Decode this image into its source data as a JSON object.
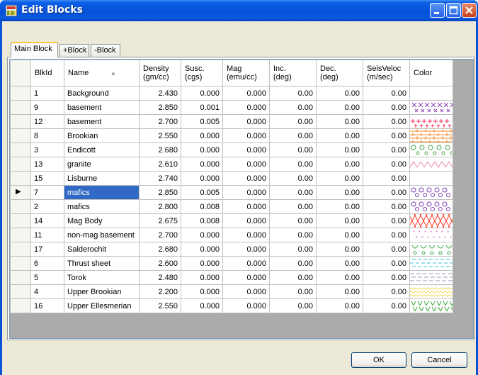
{
  "window": {
    "title": "Edit Blocks"
  },
  "tabs": [
    "Main Block",
    "+Block",
    "-Block"
  ],
  "columns": [
    {
      "l1": "",
      "l2": ""
    },
    {
      "l1": "BlkId",
      "l2": ""
    },
    {
      "l1": "Name",
      "l2": ""
    },
    {
      "l1": "Density",
      "l2": "(gm/cc)"
    },
    {
      "l1": "Susc.",
      "l2": "(cgs)"
    },
    {
      "l1": "Mag",
      "l2": "(emu/cc)"
    },
    {
      "l1": "Inc.",
      "l2": "(deg)"
    },
    {
      "l1": "Dec.",
      "l2": "(deg)"
    },
    {
      "l1": "SeisVeloc",
      "l2": "(m/sec)"
    },
    {
      "l1": "Color",
      "l2": ""
    }
  ],
  "rows": [
    {
      "id": "1",
      "name": "Background",
      "density": "2.430",
      "susc": "0.000",
      "mag": "0.000",
      "inc": "0.00",
      "dec": "0.00",
      "seis": "0.00",
      "swatch": "blank"
    },
    {
      "id": "9",
      "name": "basement",
      "density": "2.850",
      "susc": "0.001",
      "mag": "0.000",
      "inc": "0.00",
      "dec": "0.00",
      "seis": "0.00",
      "swatch": "purple-x"
    },
    {
      "id": "12",
      "name": "basement",
      "density": "2.700",
      "susc": "0.005",
      "mag": "0.000",
      "inc": "0.00",
      "dec": "0.00",
      "seis": "0.00",
      "swatch": "red-plus"
    },
    {
      "id": "8",
      "name": "Brookian",
      "density": "2.550",
      "susc": "0.000",
      "mag": "0.000",
      "inc": "0.00",
      "dec": "0.00",
      "seis": "0.00",
      "swatch": "orange-brick"
    },
    {
      "id": "3",
      "name": "Endicott",
      "density": "2.680",
      "susc": "0.000",
      "mag": "0.000",
      "inc": "0.00",
      "dec": "0.00",
      "seis": "0.00",
      "swatch": "green-circles"
    },
    {
      "id": "13",
      "name": "granite",
      "density": "2.610",
      "susc": "0.000",
      "mag": "0.000",
      "inc": "0.00",
      "dec": "0.00",
      "seis": "0.00",
      "swatch": "pink-waves"
    },
    {
      "id": "15",
      "name": "Lisburne",
      "density": "2.740",
      "susc": "0.000",
      "mag": "0.000",
      "inc": "0.00",
      "dec": "0.00",
      "seis": "0.00",
      "swatch": "blank"
    },
    {
      "id": "7",
      "name": "mafics",
      "density": "2.850",
      "susc": "0.005",
      "mag": "0.000",
      "inc": "0.00",
      "dec": "0.00",
      "seis": "0.00",
      "swatch": "purple-circles"
    },
    {
      "id": "2",
      "name": "mafics",
      "density": "2.800",
      "susc": "0.008",
      "mag": "0.000",
      "inc": "0.00",
      "dec": "0.00",
      "seis": "0.00",
      "swatch": "purple-circles"
    },
    {
      "id": "14",
      "name": "Mag Body",
      "density": "2.675",
      "susc": "0.008",
      "mag": "0.000",
      "inc": "0.00",
      "dec": "0.00",
      "seis": "0.00",
      "swatch": "red-cross"
    },
    {
      "id": "11",
      "name": "non-mag basement",
      "density": "2.700",
      "susc": "0.000",
      "mag": "0.000",
      "inc": "0.00",
      "dec": "0.00",
      "seis": "0.00",
      "swatch": "pink-stars"
    },
    {
      "id": "17",
      "name": "Salderochit",
      "density": "2.680",
      "susc": "0.000",
      "mag": "0.000",
      "inc": "0.00",
      "dec": "0.00",
      "seis": "0.00",
      "swatch": "green-u"
    },
    {
      "id": "6",
      "name": "Thrust sheet",
      "density": "2.600",
      "susc": "0.000",
      "mag": "0.000",
      "inc": "0.00",
      "dec": "0.00",
      "seis": "0.00",
      "swatch": "cyan-dash"
    },
    {
      "id": "5",
      "name": "Torok",
      "density": "2.480",
      "susc": "0.000",
      "mag": "0.000",
      "inc": "0.00",
      "dec": "0.00",
      "seis": "0.00",
      "swatch": "gray-dash"
    },
    {
      "id": "4",
      "name": "Upper Brookian",
      "density": "2.200",
      "susc": "0.000",
      "mag": "0.000",
      "inc": "0.00",
      "dec": "0.00",
      "seis": "0.00",
      "swatch": "yellow-wave"
    },
    {
      "id": "16",
      "name": "Upper Ellesmerian",
      "density": "2.550",
      "susc": "0.000",
      "mag": "0.000",
      "inc": "0.00",
      "dec": "0.00",
      "seis": "0.00",
      "swatch": "green-v"
    }
  ],
  "selected_row": 7,
  "sort_column": "Name",
  "buttons": {
    "ok": "OK",
    "cancel": "Cancel"
  },
  "colors": {
    "title_bar": "#0a5fe6",
    "selection": "#316ac5",
    "dialog_bg": "#ece9d8",
    "grid_bg": "#ababab"
  },
  "icons": {
    "window": "app-window-icon",
    "minimize": "minimize-icon",
    "maximize": "maximize-icon",
    "close": "close-icon",
    "sort": "sort-ascending-icon",
    "row_pointer": "current-row-arrow-icon"
  }
}
